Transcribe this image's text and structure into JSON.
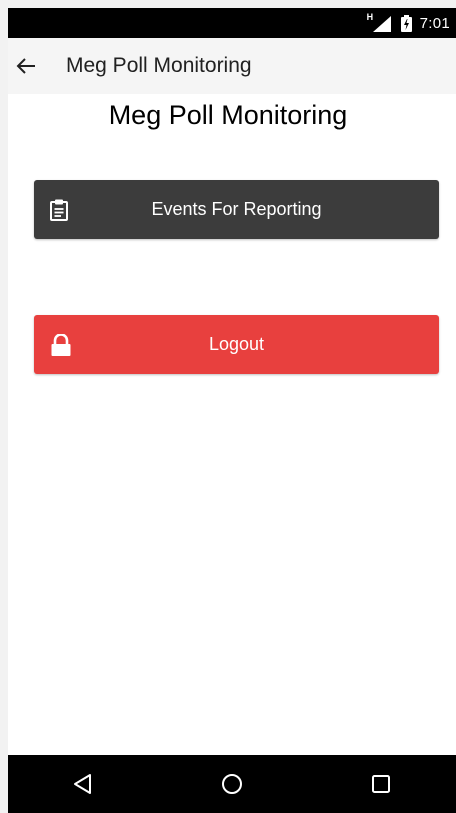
{
  "status_bar": {
    "network_label": "H",
    "time": "7:01"
  },
  "toolbar": {
    "title": "Meg Poll Monitoring",
    "back_icon": "arrow-left-icon"
  },
  "main": {
    "heading": "Meg Poll Monitoring",
    "buttons": [
      {
        "label": "Events For Reporting",
        "icon": "clipboard-icon",
        "color": "#3c3c3c"
      },
      {
        "label": "Logout",
        "icon": "lock-icon",
        "color": "#e8403e"
      }
    ]
  },
  "nav_bar": {
    "items": [
      "back-triangle-icon",
      "home-circle-icon",
      "recents-square-icon"
    ]
  }
}
